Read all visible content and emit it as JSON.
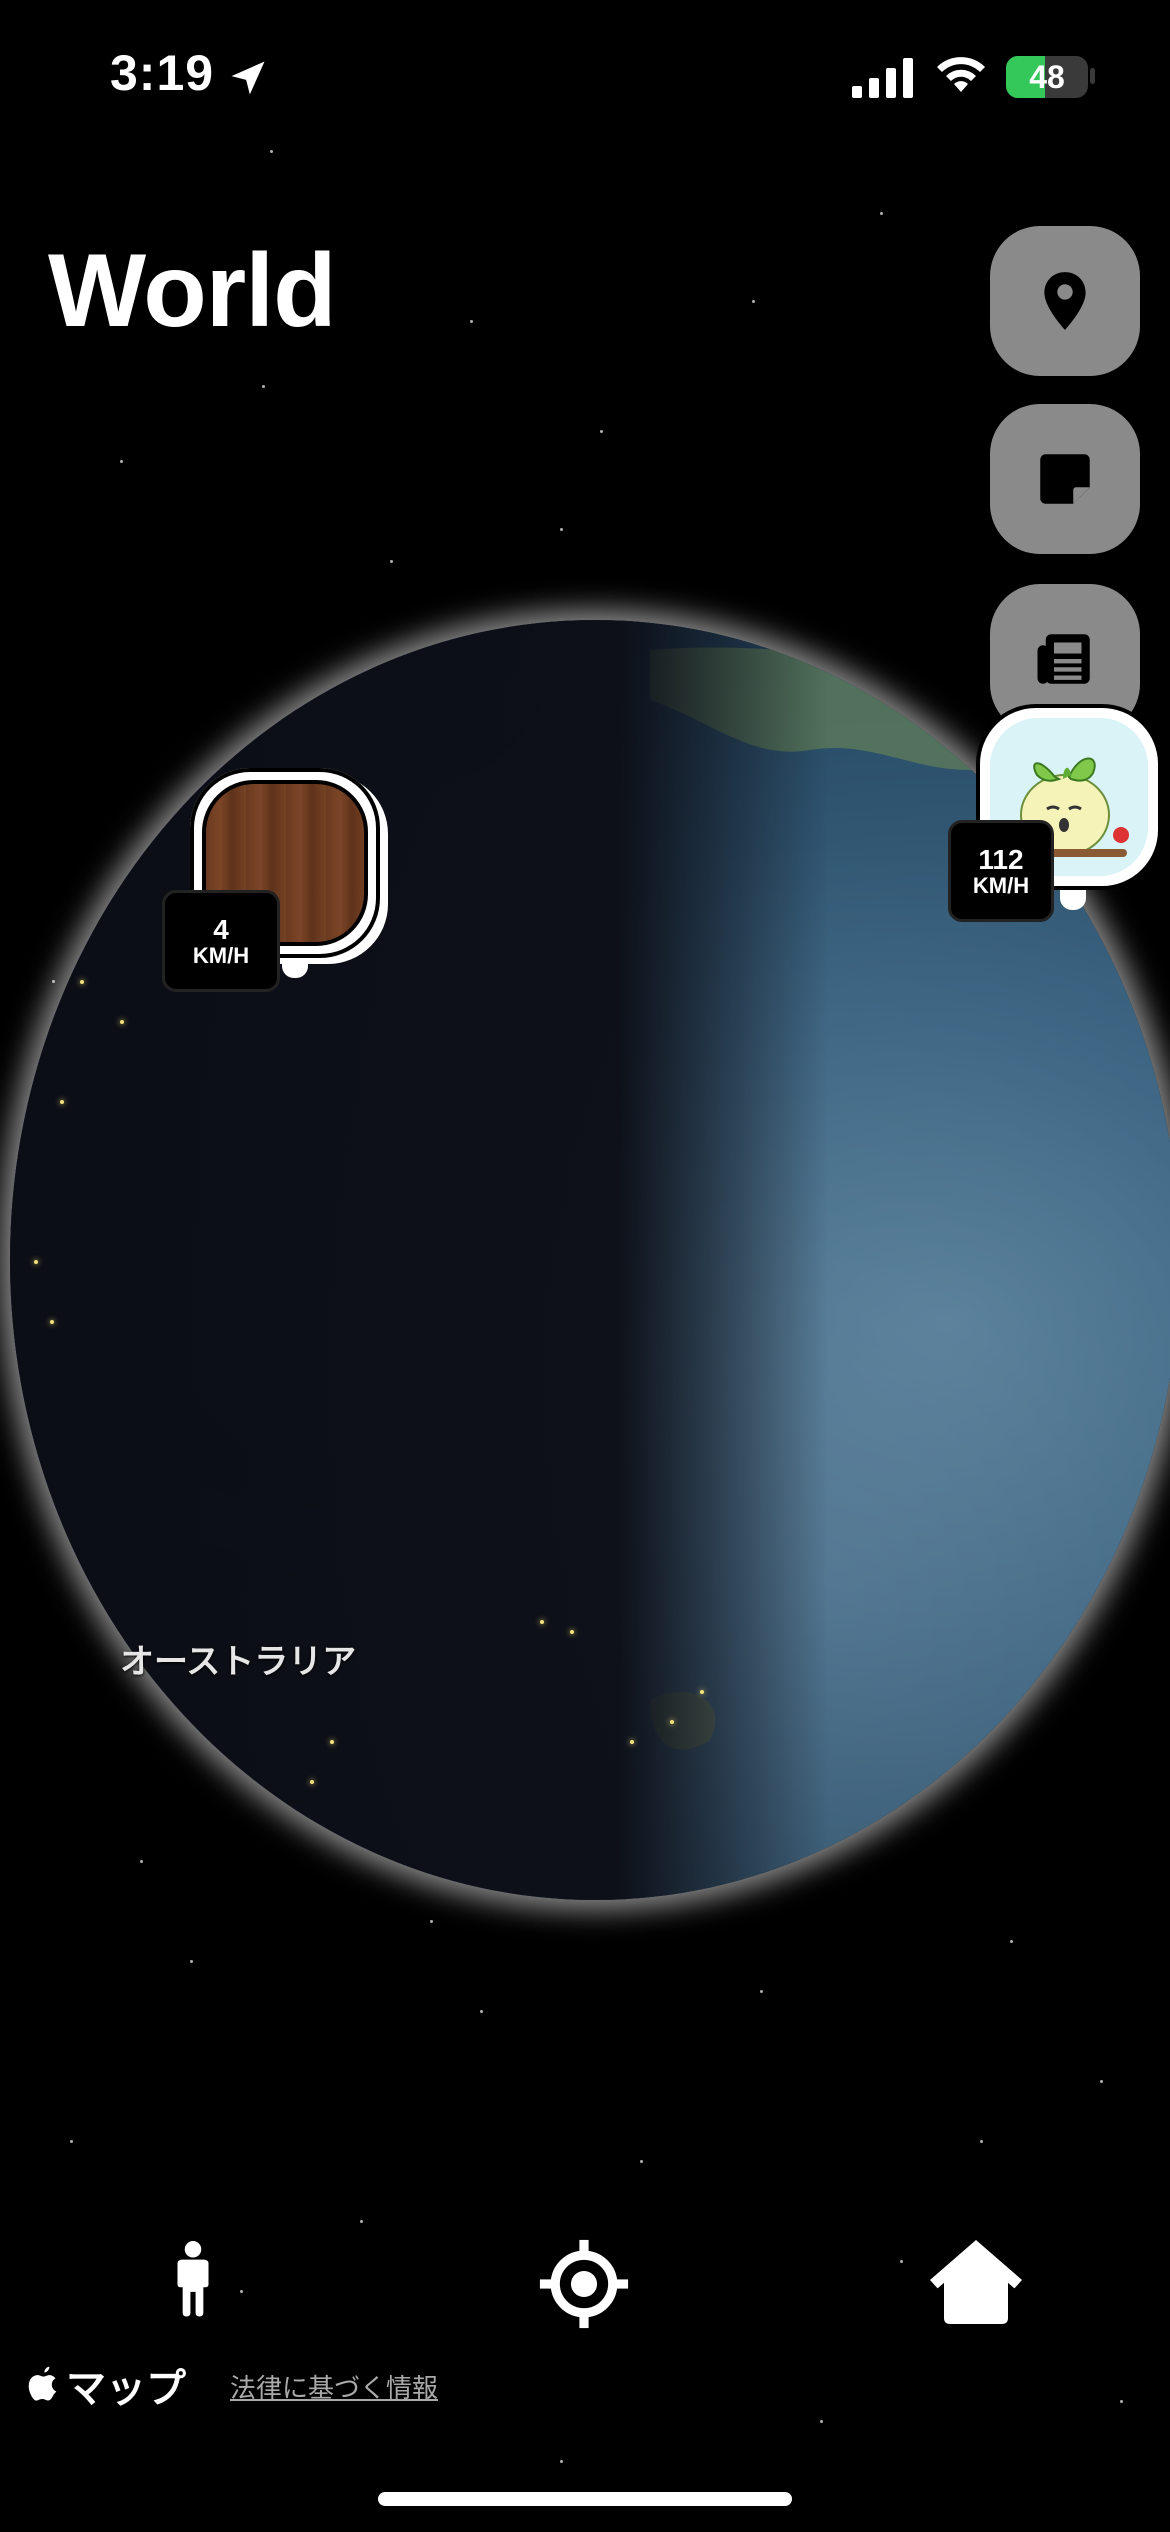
{
  "status_bar": {
    "time": "3:19",
    "battery_percent": "48",
    "battery_level": 0.48,
    "location_icon": "location-arrow-icon",
    "signal_icon": "cellular-signal-icon",
    "wifi_icon": "wifi-icon",
    "battery_color": "#34c759"
  },
  "header": {
    "title": "World"
  },
  "side_buttons": [
    {
      "name": "location-pin-button",
      "icon": "map-pin-icon"
    },
    {
      "name": "note-button",
      "icon": "sticky-note-icon"
    },
    {
      "name": "news-button",
      "icon": "newspaper-icon"
    }
  ],
  "map": {
    "region_label": "オーストラリア"
  },
  "markers": [
    {
      "name": "friend-marker-1",
      "speed_value": "4",
      "speed_unit": "KM/H"
    },
    {
      "name": "friend-marker-2",
      "speed_value": "112",
      "speed_unit": "KM/H"
    }
  ],
  "bottom_bar": {
    "left_icon": "person-walking-icon",
    "center_icon": "locate-crosshair-icon",
    "right_icon": "home-icon"
  },
  "attribution": {
    "maps_label": "マップ",
    "legal_link": "法律に基づく情報"
  },
  "colors": {
    "background": "#000000",
    "button_gray": "#8a8a8a",
    "ocean": "#3b6482"
  }
}
